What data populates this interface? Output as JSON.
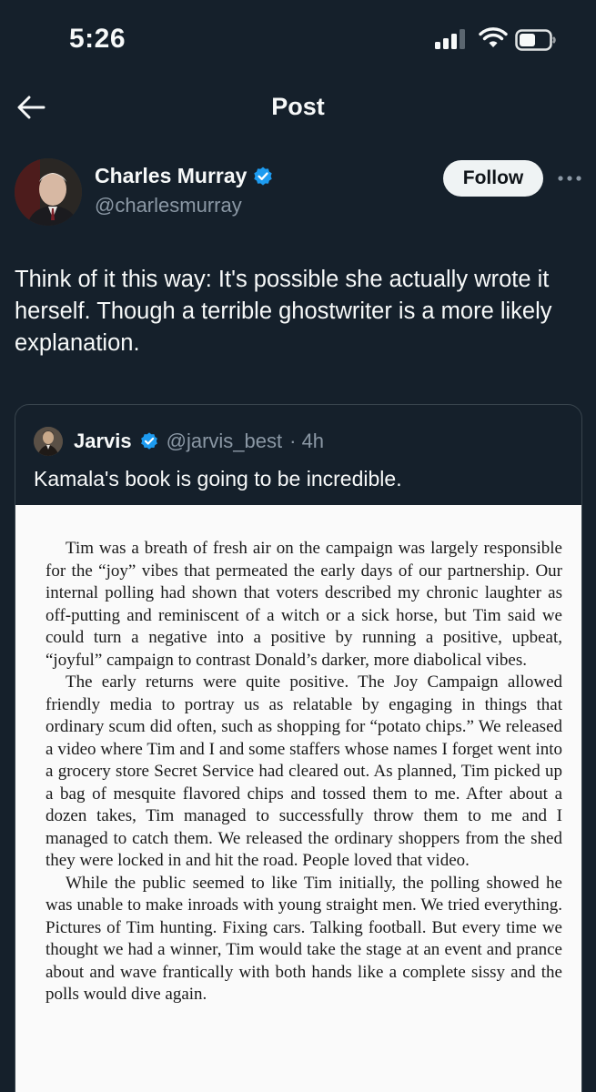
{
  "status_bar": {
    "time": "5:26",
    "icons": [
      "signal-icon",
      "wifi-icon",
      "battery-icon"
    ]
  },
  "header": {
    "title": "Post",
    "back_icon": "back-arrow-icon"
  },
  "post": {
    "author": {
      "name": "Charles Murray",
      "handle": "@charlesmurray",
      "verified": true
    },
    "follow_label": "Follow",
    "text": "Think of it this way: It's possible she actually wrote it herself. Though a terrible ghostwriter is a more likely explanation."
  },
  "quote": {
    "author": {
      "name": "Jarvis",
      "handle": "@jarvis_best",
      "time": "· 4h",
      "verified": true
    },
    "text": "Kamala's book is going to be incredible.",
    "book_paragraphs": [
      "Tim was a breath of fresh air on the campaign was largely responsible for the “joy” vibes that permeated the early days of our partnership. Our internal polling had shown that voters described my chronic laughter as off-putting and reminiscent of a witch or a sick horse, but Tim said we could turn a negative into a positive by running a positive, upbeat, “joyful” campaign to contrast Donald’s darker, more diabolical vibes.",
      "The early returns were quite positive. The Joy Campaign allowed friendly media to portray us as relatable by engaging in things that ordinary scum did often, such as shopping for “potato chips.” We released a video where Tim and I and some staffers whose names I forget went into a grocery store Secret Service had cleared out. As planned, Tim picked up a bag of mesquite flavored chips and tossed them to me. After about a dozen takes, Tim managed to successfully throw them to me and I managed to catch them. We released the ordinary shoppers from the shed they were locked in and hit the road. People loved that video.",
      "While the public seemed to like Tim initially, the polling showed he was unable to make inroads with young straight men. We tried everything. Pictures of Tim hunting. Fixing cars. Talking football. But every time we thought we had a winner, Tim would take the stage at an event and prance about and wave frantically with both hands like a complete sissy and the polls would dive again."
    ]
  },
  "colors": {
    "background": "#15202b",
    "text": "#f7f9f9",
    "secondary": "#8b98a5",
    "verified": "#1d9bf0",
    "follow_bg": "#eff3f4",
    "border": "#38444d"
  }
}
